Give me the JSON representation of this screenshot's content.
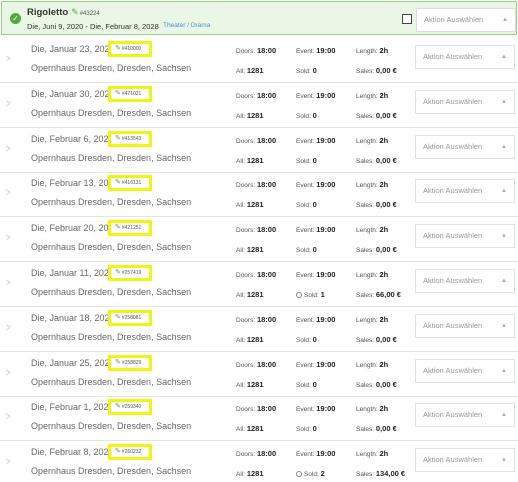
{
  "header": {
    "title": "Rigoletto",
    "id": "#43224",
    "dates": "Die, Juni 9, 2020 - Die, Februar 8, 2028",
    "genre": "Theater / Drama",
    "action_placeholder": "Aktion Auswählen"
  },
  "labels": {
    "doors": "Doors:",
    "event": "Event:",
    "length": "Length:",
    "all": "All:",
    "sold": "Sold:",
    "sales": "Sales:"
  },
  "events": [
    {
      "date": "Die, Januar 23, 2024",
      "id": "#410000",
      "venue": "Opernhaus Dresden, Dresden, Sachsen",
      "doors": "18:00",
      "event": "19:00",
      "length": "2h",
      "all": "1281",
      "sold": "0",
      "sales": "0,00 €",
      "action": "Aktion Auswählen"
    },
    {
      "date": "Die, Januar 30, 2024",
      "id": "#471021",
      "venue": "Opernhaus Dresden, Dresden, Sachsen",
      "doors": "18:00",
      "event": "19:00",
      "length": "2h",
      "all": "1281",
      "sold": "0",
      "sales": "0,00 €",
      "action": "Aktion Auswählen"
    },
    {
      "date": "Die, Februar 6, 2024",
      "id": "#413543",
      "venue": "Opernhaus Dresden, Dresden, Sachsen",
      "doors": "18:00",
      "event": "19:00",
      "length": "2h",
      "all": "1281",
      "sold": "0",
      "sales": "0,00 €",
      "action": "Aktion Auswählen"
    },
    {
      "date": "Die, Februar 13, 2024",
      "id": "#416131",
      "venue": "Opernhaus Dresden, Dresden, Sachsen",
      "doors": "18:00",
      "event": "19:00",
      "length": "2h",
      "all": "1281",
      "sold": "0",
      "sales": "0,00 €",
      "action": "Aktion Auswählen"
    },
    {
      "date": "Die, Februar 20, 2024",
      "id": "#421251",
      "venue": "Opernhaus Dresden, Dresden, Sachsen",
      "doors": "18:00",
      "event": "19:00",
      "length": "2h",
      "all": "1281",
      "sold": "0",
      "sales": "0,00 €",
      "action": "Aktion Auswählen"
    },
    {
      "date": "Die, Januar 11, 2028",
      "id": "#257419",
      "venue": "Opernhaus Dresden, Dresden, Sachsen",
      "doors": "18:00",
      "event": "19:00",
      "length": "2h",
      "all": "1281",
      "sold": "1",
      "sales": "66,00 €",
      "sold_icon": true,
      "action": "Aktion Auswählen"
    },
    {
      "date": "Die, Januar 18, 2028",
      "id": "#258081",
      "venue": "Opernhaus Dresden, Dresden, Sachsen",
      "doors": "18:00",
      "event": "19:00",
      "length": "2h",
      "all": "1281",
      "sold": "0",
      "sales": "0,00 €",
      "action": "Aktion Auswählen"
    },
    {
      "date": "Die, Januar 25, 2028",
      "id": "#258829",
      "venue": "Opernhaus Dresden, Dresden, Sachsen",
      "doors": "18:00",
      "event": "19:00",
      "length": "2h",
      "all": "1281",
      "sold": "0",
      "sales": "0,00 €",
      "action": "Aktion Auswählen"
    },
    {
      "date": "Die, Februar 1, 2028",
      "id": "#259340",
      "venue": "Opernhaus Dresden, Dresden, Sachsen",
      "doors": "18:00",
      "event": "19:00",
      "length": "2h",
      "all": "1281",
      "sold": "0",
      "sales": "0,00 €",
      "action": "Aktion Auswählen"
    },
    {
      "date": "Die, Februar 8, 2028",
      "id": "#260232",
      "venue": "Opernhaus Dresden, Dresden, Sachsen",
      "doors": "18:00",
      "event": "19:00",
      "length": "2h",
      "all": "1281",
      "sold": "2",
      "sales": "134,00 €",
      "sold_icon": true,
      "action": "Aktion Auswählen"
    }
  ]
}
